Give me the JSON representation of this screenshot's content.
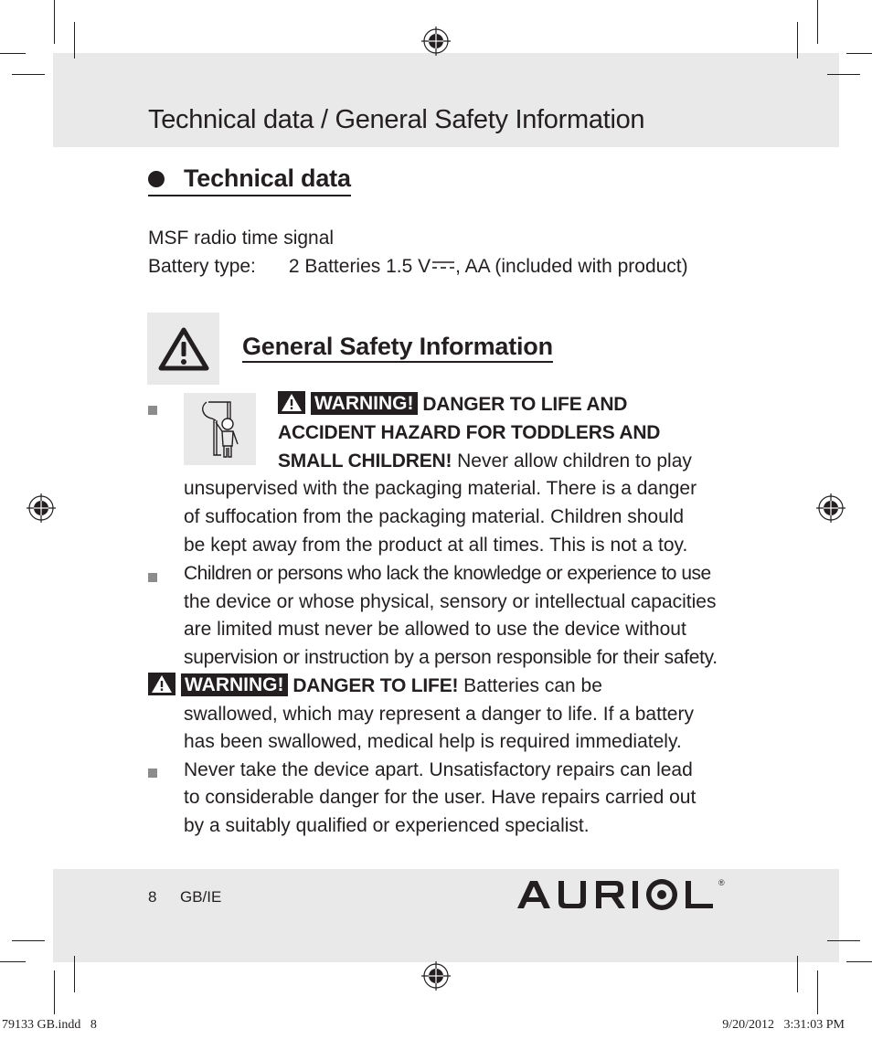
{
  "header": {
    "title": "Technical data / General Safety Information"
  },
  "technical_data": {
    "heading": "Technical data",
    "line1": "MSF radio time signal",
    "battery_label": "Battery type:",
    "battery_value_prefix": "2 Batteries 1.5 V",
    "battery_value_suffix": ", AA (included with product)"
  },
  "safety": {
    "heading": "General Safety Information",
    "warning_tag": "WARNING!",
    "item1": {
      "bold_line1": "DANGER TO LIFE AND",
      "bold_line2": "ACCIDENT HAZARD FOR TODDLERS AND",
      "bold_line3": "SMALL CHILDREN!",
      "line3_rest": " Never allow children to play",
      "line4": "unsupervised with the packaging material. There is a danger",
      "line5": "of suffocation from the packaging material. Children should",
      "line6": "be kept away from the product at all times. This is not a toy."
    },
    "item2": {
      "line1": "Children or persons who lack the knowledge or experience to use",
      "line2": "the device or whose physical, sensory or intellectual capacities",
      "line3": "are limited must never be allowed to use the device without",
      "line4": "supervision or instruction by a person responsible for their safety."
    },
    "item3": {
      "bold": "DANGER TO LIFE!",
      "line1_rest": " Batteries can be",
      "line2": "swallowed, which may represent a danger to life. If a battery",
      "line3": "has been swallowed, medical help is required immediately."
    },
    "item4": {
      "line1": "Never take the device apart. Unsatisfactory repairs can lead",
      "line2": "to considerable danger for the user. Have repairs carried out",
      "line3": "by a suitably qualified or experienced specialist."
    }
  },
  "footer": {
    "page_number": "8",
    "region": "GB/IE",
    "brand": "AURIOL",
    "brand_mark": "®"
  },
  "print_slug": {
    "file": "79133 GB.indd   8",
    "timestamp": "9/20/2012   3:31:03 PM"
  },
  "icons": {
    "warning": "warning-triangle-icon",
    "child": "child-at-window-icon",
    "dc": "dc-current-symbol-icon",
    "registration": "registration-mark-icon"
  }
}
